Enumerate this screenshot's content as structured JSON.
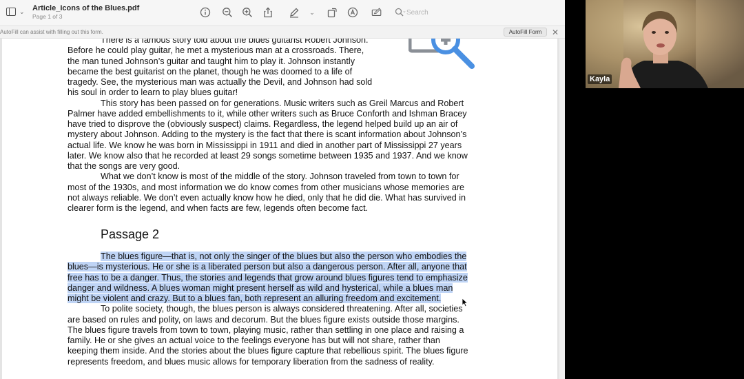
{
  "window": {
    "title": "Article_Icons of the Blues.pdf",
    "subtitle": "Page 1 of 3"
  },
  "toolbar": {
    "icons": [
      "sidebar-icon",
      "info-icon",
      "zoom-out-icon",
      "zoom-in-icon",
      "share-icon",
      "markup-pen-icon",
      "rotate-icon",
      "markup-icon",
      "form-fill-icon",
      "search-icon"
    ],
    "search_placeholder": "Search"
  },
  "autofill": {
    "message": "AutoFill can assist with filling out this form.",
    "button_label": "AutoFill Form"
  },
  "document": {
    "passage1_lines": [
      "There is a famous story told about the blues guitarist Robert Johnson.",
      "Before he could play guitar, he met a mysterious man at a crossroads. There,",
      "the man tuned Johnson’s guitar and taught him to play it. Johnson instantly",
      "became the best guitarist on the planet, though he was doomed to a life of",
      "tragedy. See, the mysterious man was actually the Devil, and Johnson had sold",
      "his soul in order to learn to play blues guitar!",
      "This story has been passed on for generations. Music writers such as Greil Marcus and Robert",
      "Palmer have added embellishments to it, while other writers such as Bruce Conforth and Ishman Bracey",
      "have tried to disprove the (obviously suspect) claims. Regardless, the legend helped build up an air of",
      "mystery about Johnson. Adding to the mystery is the fact that there is scant information about Johnson’s",
      "actual life. We know he was born in Mississippi in 1911 and died in another part of Mississippi 27 years",
      "later. We know also that he recorded at least 29 songs sometime between 1935 and 1937. And we know",
      "that the songs are very good.",
      "What we don’t know is most of the middle of the story. Johnson traveled from town to town for",
      "most of the 1930s, and most information we do know comes from other musicians whose memories are",
      "not always reliable. We don’t even actually know how he died, only that he did die. What has survived in",
      "clearer form is the legend, and when facts are few, legends often become fact."
    ],
    "passage2_heading": "Passage 2",
    "passage2_lines": [
      "The blues figure—that is, not only the singer of the blues but also the person who embodies the",
      "blues—is mysterious. He or she is a liberated person but also a dangerous person. After all, anyone that",
      "free has to be a danger. Thus, the stories and legends that grow around blues figures tend to emphasize",
      "danger and wildness. A blues woman might present herself as wild and hysterical, while a blues man",
      "might be violent and crazy. But to a blues fan, both represent an alluring freedom and excitement.",
      "To polite society, though, the blues person is always considered threatening. After all, societies",
      "are based on rules and polity, on laws and decorum. But the blues figure exists outside those margins.",
      "The blues figure travels from town to town, playing music, rather than settling in one place and raising a",
      "family. He or she gives an actual voice to the feelings everyone has but will not share, rather than",
      "keeping them inside. And the stories about the blues figure capture that rebellious spirit. The blues figure",
      "represents freedom, and blues music allows for temporary liberation from the sadness of reality."
    ]
  },
  "video": {
    "participant_name": "Kayla"
  },
  "colors": {
    "highlight": "#bfd4f5",
    "toolbar_bg": "#f6f6f6",
    "magnifier_blue": "#4a90e2"
  }
}
